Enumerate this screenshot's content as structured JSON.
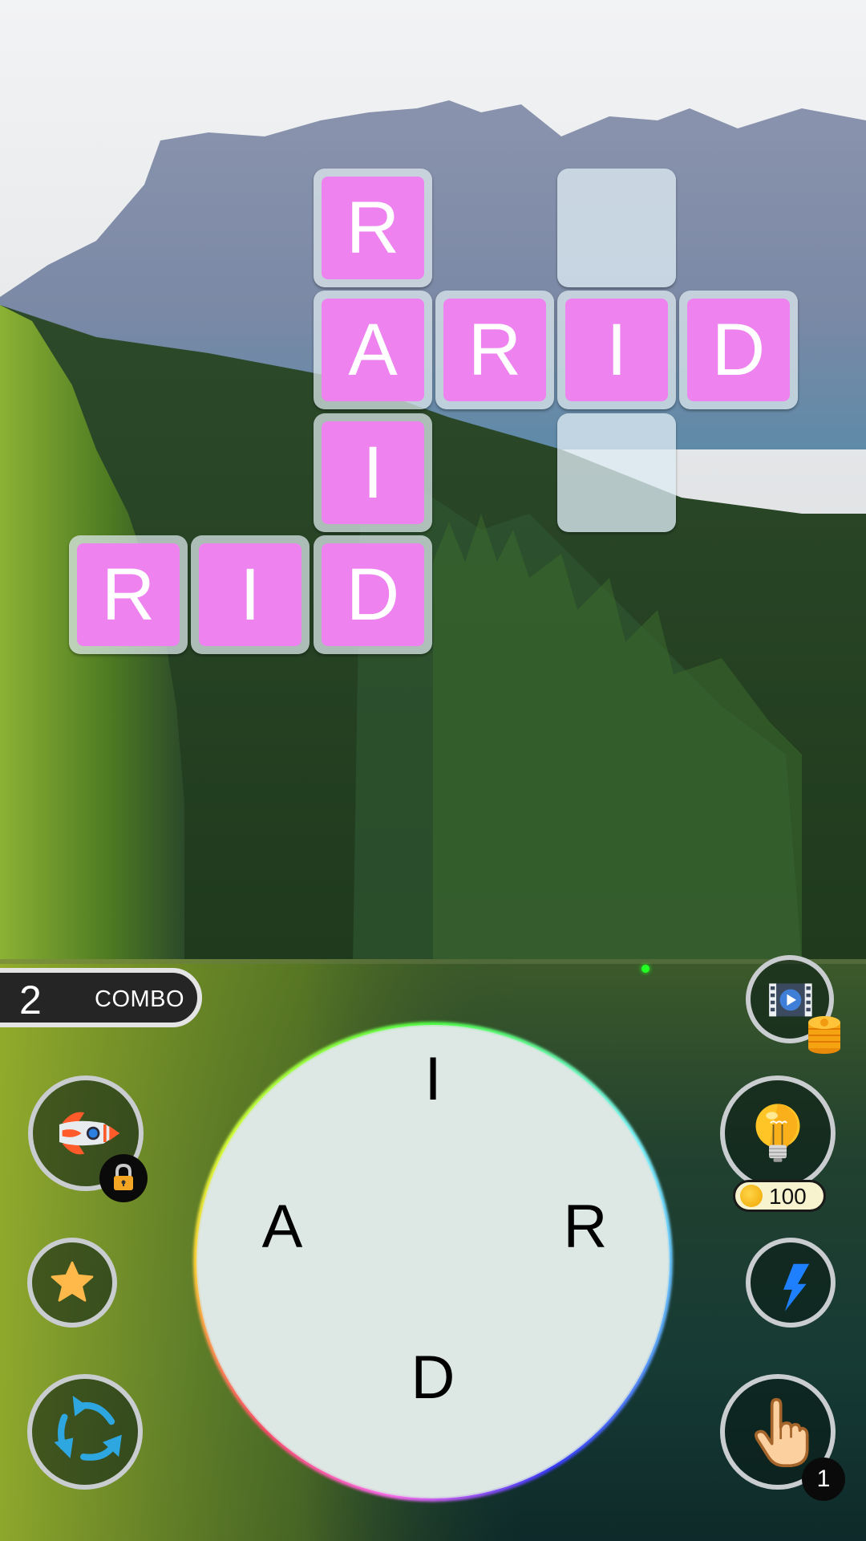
{
  "game": {
    "accent_tile_color": "#ee82ee",
    "tile_letter_color": "#ffffff",
    "grid": {
      "columns": 5,
      "rows": 4,
      "cells": [
        {
          "row": 0,
          "col": 2,
          "letter": "R",
          "state": "filled"
        },
        {
          "row": 0,
          "col": 4,
          "letter": "",
          "state": "empty"
        },
        {
          "row": 1,
          "col": 2,
          "letter": "A",
          "state": "filled"
        },
        {
          "row": 1,
          "col": 3,
          "letter": "R",
          "state": "filled"
        },
        {
          "row": 1,
          "col": 4,
          "letter": "I",
          "state": "filled"
        },
        {
          "row": 1,
          "col": 5,
          "letter": "D",
          "state": "filled"
        },
        {
          "row": 2,
          "col": 2,
          "letter": "I",
          "state": "filled"
        },
        {
          "row": 2,
          "col": 4,
          "letter": "",
          "state": "empty"
        },
        {
          "row": 3,
          "col": 0,
          "letter": "R",
          "state": "filled"
        },
        {
          "row": 3,
          "col": 1,
          "letter": "I",
          "state": "filled"
        },
        {
          "row": 3,
          "col": 2,
          "letter": "D",
          "state": "filled"
        }
      ],
      "found_words": [
        "RAID",
        "ARID",
        "RID"
      ]
    },
    "combo": {
      "count": "2",
      "label": "COMBO"
    },
    "letter_wheel": {
      "letters": [
        {
          "letter": "I",
          "position": "top"
        },
        {
          "letter": "R",
          "position": "right"
        },
        {
          "letter": "D",
          "position": "bottom"
        },
        {
          "letter": "A",
          "position": "left"
        }
      ]
    },
    "left_buttons": [
      {
        "name": "rocket-booster-button",
        "icon": "rocket-icon",
        "locked": true
      },
      {
        "name": "extra-words-button",
        "icon": "star-icon"
      },
      {
        "name": "shuffle-button",
        "icon": "shuffle-icon"
      }
    ],
    "right_buttons": [
      {
        "name": "watch-video-coins-button",
        "icon": "video-coins-icon"
      },
      {
        "name": "hint-button",
        "icon": "lightbulb-icon",
        "price": "100"
      },
      {
        "name": "lightning-button",
        "icon": "lightning-icon"
      },
      {
        "name": "finger-hint-button",
        "icon": "pointing-hand-icon",
        "count": "1"
      }
    ]
  }
}
